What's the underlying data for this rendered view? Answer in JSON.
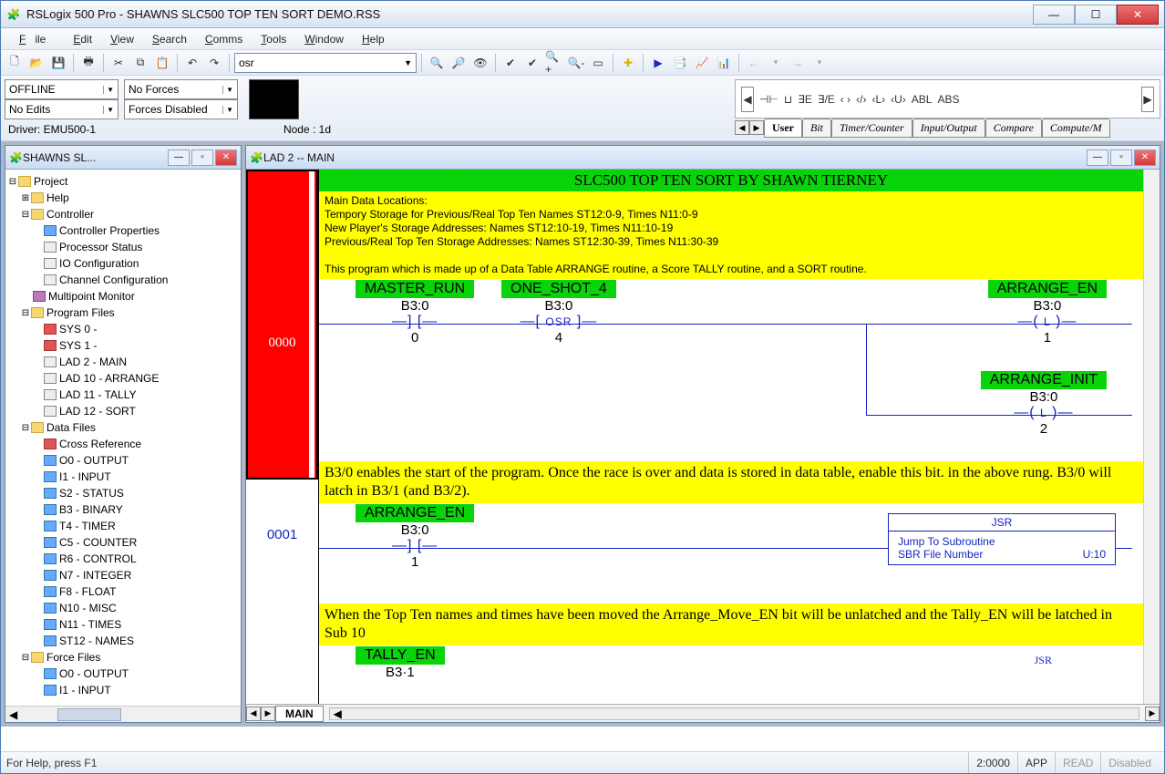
{
  "window": {
    "title": "RSLogix 500 Pro - SHAWNS SLC500 TOP TEN SORT DEMO.RSS"
  },
  "menu": {
    "file": "File",
    "edit": "Edit",
    "view": "View",
    "search": "Search",
    "comms": "Comms",
    "tools": "Tools",
    "window": "Window",
    "help": "Help"
  },
  "toolbar": {
    "combo": "osr"
  },
  "status": {
    "offline": "OFFLINE",
    "noforces": "No Forces",
    "noedits": "No Edits",
    "forcesdisabled": "Forces Disabled",
    "driver": "Driver: EMU500-1",
    "node": "Node : 1d"
  },
  "instr_tabs": {
    "user": "User",
    "bit": "Bit",
    "timer": "Timer/Counter",
    "io": "Input/Output",
    "compare": "Compare",
    "compute": "Compute/M"
  },
  "instr_items": [
    "⊣⊢",
    "⊔",
    "∃E",
    "∃/E",
    "‹ ›",
    "‹/›",
    "‹L›",
    "‹U›",
    "ABL",
    "ABS"
  ],
  "treewin": {
    "title": "SHAWNS SL..."
  },
  "tree": {
    "project": "Project",
    "help": "Help",
    "controller": "Controller",
    "controller_props": "Controller Properties",
    "proc_status": "Processor Status",
    "io_config": "IO Configuration",
    "chan_config": "Channel Configuration",
    "multipoint": "Multipoint Monitor",
    "program_files": "Program Files",
    "sys0": "SYS 0 -",
    "sys1": "SYS 1 -",
    "lad2": "LAD 2 - MAIN",
    "lad10": "LAD 10 - ARRANGE",
    "lad11": "LAD 11 - TALLY",
    "lad12": "LAD 12 - SORT",
    "data_files": "Data Files",
    "cross": "Cross Reference",
    "o0": "O0 - OUTPUT",
    "i1": "I1 - INPUT",
    "s2": "S2 - STATUS",
    "b3": "B3 - BINARY",
    "t4": "T4 - TIMER",
    "c5": "C5 - COUNTER",
    "r6": "R6 - CONTROL",
    "n7": "N7 - INTEGER",
    "f8": "F8 - FLOAT",
    "n10": "N10 - MISC",
    "n11": "N11 - TIMES",
    "st12": "ST12 - NAMES",
    "force_files": "Force Files",
    "fo0": "O0 - OUTPUT",
    "fi1": "I1 - INPUT"
  },
  "ladwin": {
    "title": "LAD 2 -- MAIN",
    "tab": "MAIN"
  },
  "lad": {
    "titlebar": "SLC500 TOP TEN SORT BY SHAWN TIERNEY",
    "comment0_l1": "Main Data Locations:",
    "comment0_l2": "Tempory Storage for Previous/Real Top Ten      Names ST12:0-9,      Times N11:0-9",
    "comment0_l3": "New Player's Storage Addresses:                            Names ST12:10-19, Times N11:10-19",
    "comment0_l4": "Previous/Real Top Ten Storage Addresses:          Names ST12:30-39, Times N11:30-39",
    "comment0_l5": "This program which is made up of a Data Table ARRANGE routine, a Score TALLY routine, and a SORT routine.",
    "rung0": {
      "num": "0000",
      "master": "MASTER_RUN",
      "oneshot": "ONE_SHOT_4",
      "arr_en": "ARRANGE_EN",
      "arr_init": "ARRANGE_INIT",
      "addr": "B3:0",
      "osr": "OSR",
      "b0": "0",
      "b4": "4",
      "b1": "1",
      "b2": "2",
      "L": "L"
    },
    "comment1": "B3/0 enables the start of the program. Once the race is over and data is stored in data table, enable this bit. in the above rung. B3/0 will latch in B3/1 (and B3/2).",
    "rung1": {
      "num": "0001",
      "tag": "ARRANGE_EN",
      "addr": "B3:0",
      "bit": "1",
      "jsr": "JSR",
      "jsr_desc": "Jump To Subroutine",
      "sbr": "SBR File Number",
      "sbr_val": "U:10"
    },
    "comment2": "When the Top Ten names and times have been moved the Arrange_Move_EN bit will be unlatched and the Tally_EN will be latched in Sub 10",
    "rung2": {
      "tag": "TALLY_EN",
      "addr": "B3·1",
      "jsr": "JSR"
    }
  },
  "statusbar": {
    "help": "For Help, press F1",
    "pos": "2:0000",
    "app": "APP",
    "read": "READ",
    "disabled": "Disabled"
  }
}
